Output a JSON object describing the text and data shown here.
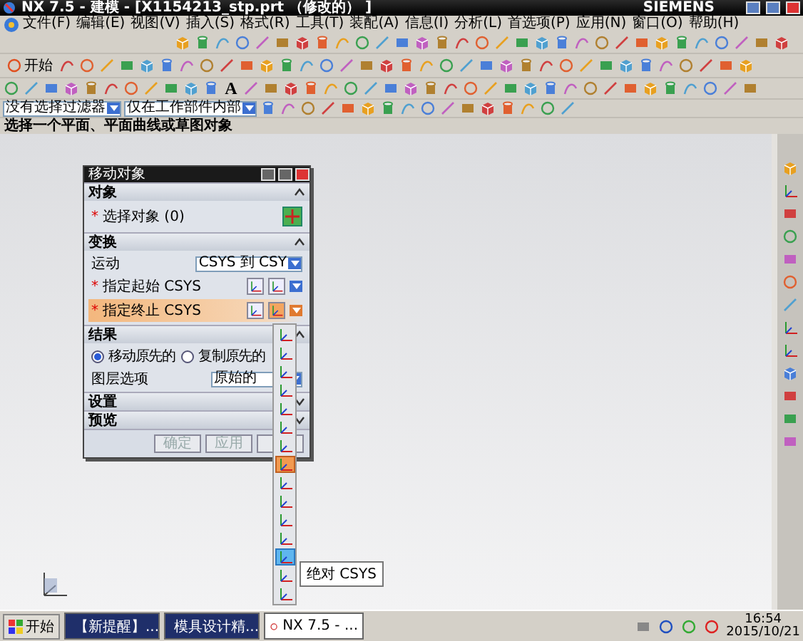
{
  "window": {
    "title": "NX 7.5 - 建模 - [X1154213_stp.prt （修改的） ]",
    "brand": "SIEMENS"
  },
  "menu": [
    "文件(F)",
    "编辑(E)",
    "视图(V)",
    "插入(S)",
    "格式(R)",
    "工具(T)",
    "装配(A)",
    "信息(I)",
    "分析(L)",
    "首选项(P)",
    "应用(N)",
    "窗口(O)",
    "帮助(H)"
  ],
  "toolbar": {
    "start_label": "开始",
    "text_tool": "A"
  },
  "filters": [
    {
      "value": "没有选择过滤器"
    },
    {
      "value": "仅在工作部件内部"
    }
  ],
  "cue": "选择一个平面、平面曲线或草图对象",
  "dialog": {
    "title": "移动对象",
    "object": {
      "title": "对象",
      "expanded": true,
      "mark": "*",
      "label": "选择对象 (0)"
    },
    "transform": {
      "title": "变换",
      "expanded": true,
      "motion_label": "运动",
      "motion_value": "CSYS 到 CSY",
      "rows": [
        {
          "mark": "*",
          "label": "指定起始 CSYS",
          "selected": false
        },
        {
          "mark": "*",
          "label": "指定终止 CSYS",
          "selected": true
        }
      ]
    },
    "result": {
      "title": "结果",
      "expanded": true,
      "options": [
        {
          "label": "移动原先的",
          "selected": true
        },
        {
          "label": "复制原先的",
          "selected": false
        }
      ],
      "layer_label": "图层选项",
      "layer_value": "原始的"
    },
    "collapsed": [
      {
        "title": "设置",
        "expanded": false
      },
      {
        "title": "预览",
        "expanded": false
      }
    ],
    "buttons": [
      {
        "label": "确定",
        "disabled": true
      },
      {
        "label": "应用",
        "disabled": true
      }
    ]
  },
  "csys_menu": {
    "items": [
      {
        "selected": false,
        "hovered": false
      },
      {
        "selected": false,
        "hovered": false
      },
      {
        "selected": false,
        "hovered": false
      },
      {
        "selected": false,
        "hovered": false
      },
      {
        "selected": false,
        "hovered": false
      },
      {
        "selected": false,
        "hovered": false
      },
      {
        "selected": false,
        "hovered": false
      },
      {
        "selected": true,
        "hovered": false
      },
      {
        "selected": false,
        "hovered": false
      },
      {
        "selected": false,
        "hovered": false
      },
      {
        "selected": false,
        "hovered": false
      },
      {
        "selected": false,
        "hovered": false
      },
      {
        "selected": false,
        "hovered": true
      },
      {
        "selected": false,
        "hovered": false
      },
      {
        "selected": false,
        "hovered": false
      }
    ],
    "tooltip": "绝对 CSYS"
  },
  "taskbar": {
    "start": "开始",
    "tasks": [
      {
        "label": "【新提醒】...",
        "active": false
      },
      {
        "label": "模具设计精...",
        "active": false
      },
      {
        "label": "NX 7.5 - ...",
        "active": true
      }
    ],
    "time": "16:54",
    "date": "2015/10/21"
  }
}
